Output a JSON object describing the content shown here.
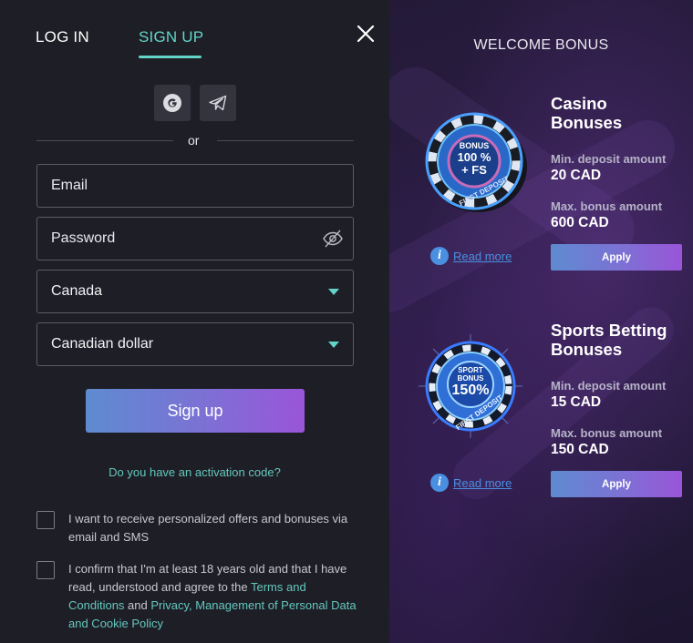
{
  "tabs": {
    "login": "LOG IN",
    "signup": "SIGN UP"
  },
  "or_text": "or",
  "form": {
    "email_placeholder": "Email",
    "password_placeholder": "Password",
    "country_value": "Canada",
    "currency_value": "Canadian dollar",
    "signup_label": "Sign up",
    "activation_link": "Do you have an activation code?"
  },
  "consents": {
    "offers": "I want to receive personalized offers and bonuses via email and SMS",
    "age_prefix": "I confirm that I'm at least 18 years old and that I have read, understood and agree to the ",
    "terms_link": "Terms and Conditions",
    "and_text": " and ",
    "privacy_link": "Privacy, Management of Personal Data and Cookie Policy"
  },
  "welcome": {
    "title": "WELCOME BONUS",
    "casino": {
      "title": "Casino Bonuses",
      "chip_line1": "BONUS",
      "chip_line2": "100 %",
      "chip_line3": "+ FS",
      "chip_ring": "FIRST DEPOSIT",
      "min_label": "Min. deposit amount",
      "min_value": "20 CAD",
      "max_label": "Max. bonus amount",
      "max_value": "600 CAD",
      "read_more": "Read more",
      "apply": "Apply"
    },
    "sports": {
      "title": "Sports Betting Bonuses",
      "chip_line1": "SPORT",
      "chip_line2": "BONUS",
      "chip_line3": "150%",
      "chip_ring": "FIRST DEPOSIT",
      "min_label": "Min. deposit amount",
      "min_value": "15 CAD",
      "max_label": "Max. bonus amount",
      "max_value": "150 CAD",
      "read_more": "Read more",
      "apply": "Apply"
    }
  },
  "colors": {
    "accent": "#63d4c8",
    "link": "#4a8fe0",
    "gradient_start": "#5e8bd0",
    "gradient_end": "#9a55d8"
  },
  "icons": [
    "close-icon",
    "google-icon",
    "telegram-icon",
    "eye-off-icon",
    "chevron-down-icon",
    "info-icon"
  ]
}
